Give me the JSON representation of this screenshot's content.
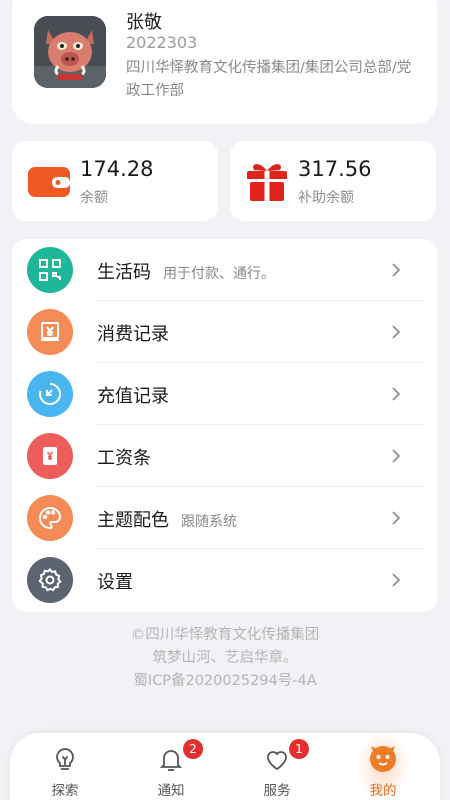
{
  "profile": {
    "name": "张敬",
    "id": "2022303",
    "department": "四川华怿教育文化传播集团/集团公司总部/党政工作部",
    "avatar_icon": "pig-cartoon-avatar"
  },
  "balances": [
    {
      "value": "174.28",
      "label": "余额",
      "icon": "wallet-icon",
      "color": "#f05a22"
    },
    {
      "value": "317.56",
      "label": "补助余额",
      "icon": "gift-icon",
      "color": "#e0231b"
    }
  ],
  "menu": [
    {
      "title": "生活码",
      "subtitle": "用于付款、通行。",
      "icon": "qr-code-icon",
      "color": "#1fb79a"
    },
    {
      "title": "消费记录",
      "subtitle": "",
      "icon": "receipt-yen-icon",
      "color": "#f58b57"
    },
    {
      "title": "充值记录",
      "subtitle": "",
      "icon": "clock-arrow-icon",
      "color": "#49b6f0"
    },
    {
      "title": "工资条",
      "subtitle": "",
      "icon": "payslip-yen-icon",
      "color": "#ee5c5c"
    },
    {
      "title": "主题配色",
      "subtitle": "跟随系统",
      "icon": "palette-icon",
      "color": "#f58b57"
    },
    {
      "title": "设置",
      "subtitle": "",
      "icon": "gear-icon",
      "color": "#5b6470"
    }
  ],
  "footer": {
    "line1": "©四川华怿教育文化传播集团",
    "line2": "筑梦山河、艺启华章。",
    "line3": "蜀ICP备2020025294号-4A"
  },
  "tabs": [
    {
      "label": "探索",
      "icon": "bulb-icon",
      "badge": ""
    },
    {
      "label": "通知",
      "icon": "bell-icon",
      "badge": "2"
    },
    {
      "label": "服务",
      "icon": "heart-icon",
      "badge": "1"
    },
    {
      "label": "我的",
      "icon": "smiley-face-icon",
      "badge": "",
      "active": true
    }
  ],
  "accent_color": "#f07c2a"
}
